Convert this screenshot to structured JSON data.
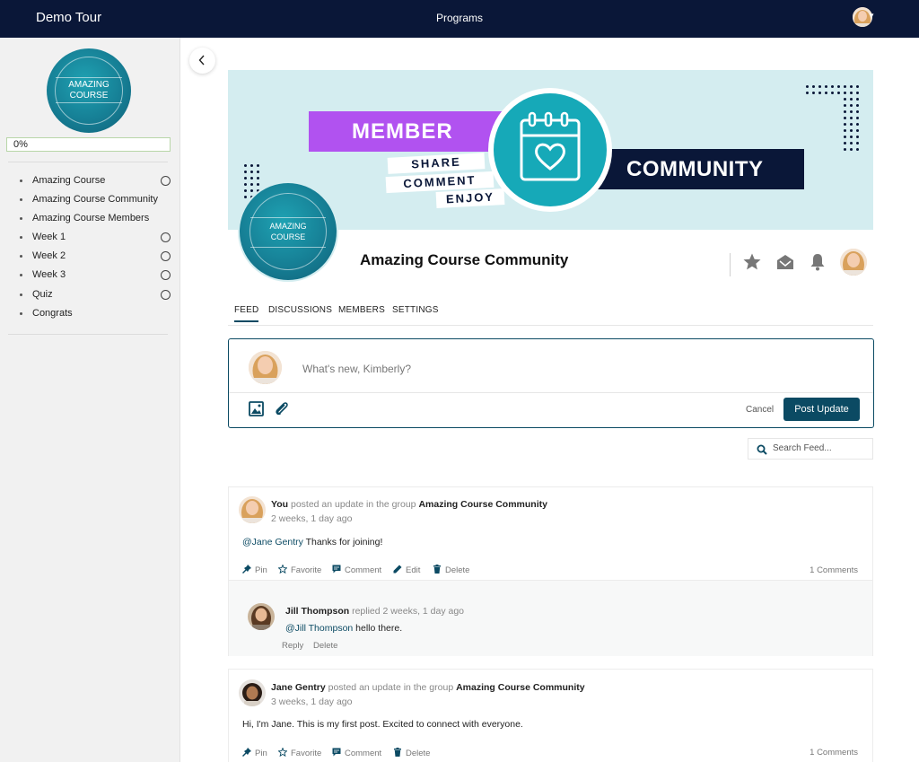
{
  "topbar": {
    "brand": "Demo Tour",
    "center_link": "Programs"
  },
  "sidebar": {
    "logo_line1": "AMAZING",
    "logo_line2": "COURSE",
    "progress": "0%",
    "progress_value": 0,
    "items": [
      {
        "label": "Amazing Course",
        "has_status": true
      },
      {
        "label": "Amazing Course Community",
        "has_status": false
      },
      {
        "label": "Amazing Course Members",
        "has_status": false
      },
      {
        "label": "Week 1",
        "has_status": true
      },
      {
        "label": "Week 2",
        "has_status": true
      },
      {
        "label": "Week 3",
        "has_status": true
      },
      {
        "label": "Quiz",
        "has_status": true
      },
      {
        "label": "Congrats",
        "has_status": false
      }
    ]
  },
  "banner": {
    "member": "MEMBER",
    "community": "COMMUNITY",
    "share": "SHARE",
    "comment": "COMMENT",
    "enjoy": "ENJOY"
  },
  "group": {
    "logo_line1": "AMAZING",
    "logo_line2": "COURSE",
    "title": "Amazing Course Community"
  },
  "tabs": [
    "FEED",
    "DISCUSSIONS",
    "MEMBERS",
    "SETTINGS"
  ],
  "composer": {
    "placeholder": "What's new, Kimberly?",
    "cancel": "Cancel",
    "post": "Post Update"
  },
  "search": {
    "placeholder": "Search Feed..."
  },
  "posts": [
    {
      "author": "You",
      "verb": "posted an update in the group",
      "group": "Amazing Course Community",
      "time": "2 weeks, 1 day ago",
      "mention": "@Jane Gentry",
      "text": "Thanks for joining!",
      "actions": [
        "Pin",
        "Favorite",
        "Comment",
        "Edit",
        "Delete"
      ],
      "comment_count": "1 Comments",
      "reply": {
        "author": "Jill Thompson",
        "verb": "replied",
        "time": "2 weeks, 1 day ago",
        "mention": "@Jill Thompson",
        "text": "hello there.",
        "actions": [
          "Reply",
          "Delete"
        ]
      }
    },
    {
      "author": "Jane Gentry",
      "verb": "posted an update in the group",
      "group": "Amazing Course Community",
      "time": "3 weeks, 1 day ago",
      "text": "Hi, I'm Jane. This is my first post. Excited to connect with everyone.",
      "actions": [
        "Pin",
        "Favorite",
        "Comment",
        "Delete"
      ],
      "comment_count": "1 Comments"
    }
  ],
  "colors": {
    "navy": "#0a1738",
    "accent": "#0b4a63",
    "purple": "#b152f0",
    "teal": "#16a9b8"
  }
}
